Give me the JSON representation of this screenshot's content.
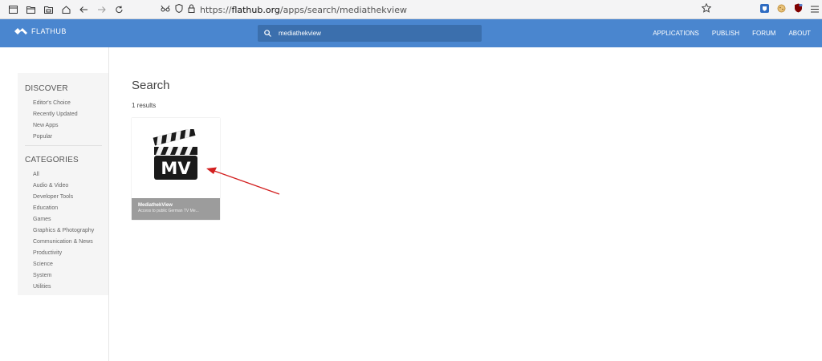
{
  "browser": {
    "url_prefix": "https://",
    "url_host": "flathub.org",
    "url_path": "/apps/search/mediathekview"
  },
  "header": {
    "logo_text": "FLATHUB",
    "search_value": "mediathekview",
    "nav": [
      "APPLICATIONS",
      "PUBLISH",
      "FORUM",
      "ABOUT"
    ]
  },
  "sidebar": {
    "discover_heading": "DISCOVER",
    "discover_items": [
      "Editor's Choice",
      "Recently Updated",
      "New Apps",
      "Popular"
    ],
    "categories_heading": "CATEGORIES",
    "category_items": [
      "All",
      "Audio & Video",
      "Developer Tools",
      "Education",
      "Games",
      "Graphics & Photography",
      "Communication & News",
      "Productivity",
      "Science",
      "System",
      "Utilities"
    ]
  },
  "main": {
    "title": "Search",
    "result_count": "1 results",
    "results": [
      {
        "icon_text": "MV",
        "name": "MediathekView",
        "description": "Access to public German TV Me..."
      }
    ]
  },
  "colors": {
    "header_bg": "#4a86cf",
    "card_footer_bg": "#9c9c9c",
    "arrow": "#d32020"
  }
}
